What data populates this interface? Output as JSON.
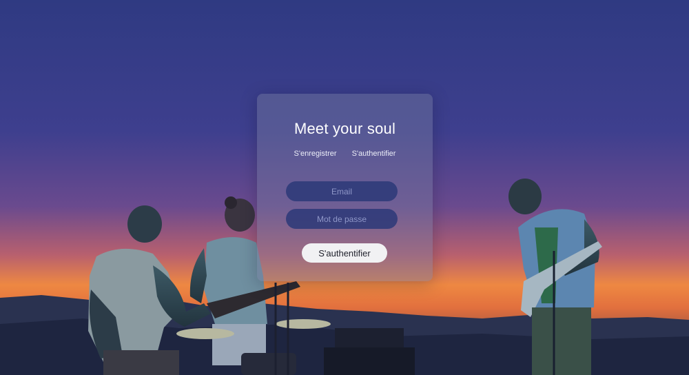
{
  "login": {
    "title": "Meet your soul",
    "tabs": [
      {
        "label": "S'enregistrer"
      },
      {
        "label": "S'authentifier"
      }
    ],
    "email_placeholder": "Email",
    "password_placeholder": "Mot de passe",
    "submit_label": "S'authentifier"
  },
  "background": {
    "scene": "band playing outdoors at dusk",
    "sky_top_color": "#2f3a82",
    "sky_mid_color": "#5b3e8a",
    "sunset_color": "#f08a3a",
    "silhouette_color": "#1f2a40"
  }
}
